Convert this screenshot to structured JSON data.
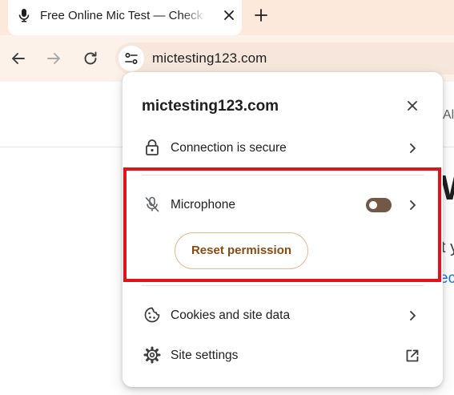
{
  "tab": {
    "title": "Free Online Mic Test — Check Your Microphone",
    "favicon": "microphone-icon"
  },
  "toolbar": {
    "url": "mictesting123.com"
  },
  "page_fragments": {
    "a": "Al",
    "w": "W",
    "t": "t y",
    "ec": "ec"
  },
  "popup": {
    "title": "mictesting123.com",
    "connection_label": "Connection is secure",
    "microphone_label": "Microphone",
    "microphone_allowed": false,
    "reset_label": "Reset permission",
    "cookies_label": "Cookies and site data",
    "settings_label": "Site settings"
  },
  "colors": {
    "highlight": "#e0121b",
    "toggle_off": "#735747",
    "reset_text": "#8a4a10",
    "tabstrip_bg": "#fde9dc"
  }
}
